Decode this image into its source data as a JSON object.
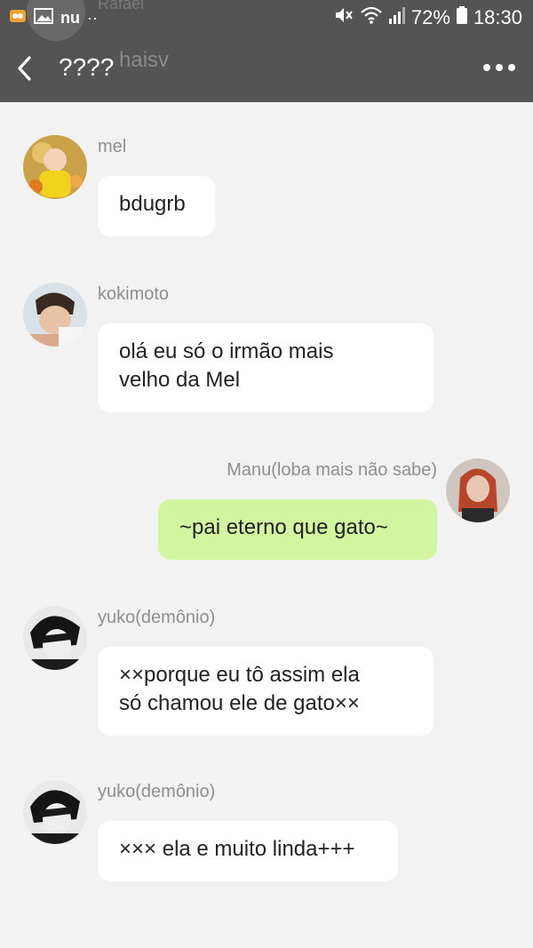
{
  "status_bar": {
    "battery": "72%",
    "time": "18:30",
    "carrier_glyph": "nu",
    "dots": "··"
  },
  "header": {
    "title": "????",
    "background_name": "Rafael",
    "background_subtitle": "haisv"
  },
  "messages": [
    {
      "author": "mel",
      "text": "bdugrb",
      "mine": false
    },
    {
      "author": "kokimoto",
      "text": "olá eu só o irmão mais\nvelho  da Mel",
      "mine": false
    },
    {
      "author": "Manu(loba mais não sabe)",
      "text": "~pai eterno que gato~",
      "mine": true
    },
    {
      "author": "yuko(demônio)",
      "text": "××porque eu tô  assim ela\nsó chamou ele de gato××",
      "mine": false
    },
    {
      "author": "yuko(demônio)",
      "text": "××× ela e muito linda+++",
      "mine": false
    }
  ],
  "colors": {
    "header_bg": "#545454",
    "chat_bg": "#f2f2f2",
    "my_bubble": "#d2f5a0",
    "other_bubble": "#ffffff"
  }
}
